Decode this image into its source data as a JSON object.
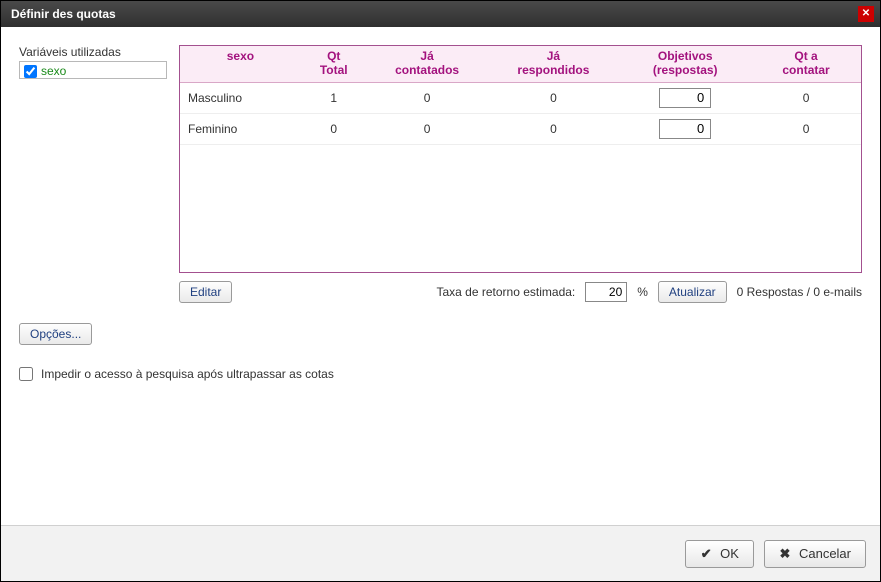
{
  "window": {
    "title": "Définir des quotas"
  },
  "left": {
    "vars_label": "Variáveis utilizadas",
    "vars": [
      {
        "name": "sexo",
        "checked": true
      }
    ]
  },
  "table": {
    "headers": {
      "col0": "sexo",
      "col1_l1": "Qt",
      "col1_l2": "Total",
      "col2_l1": "Já",
      "col2_l2": "contatados",
      "col3_l1": "Já",
      "col3_l2": "respondidos",
      "col4_l1": "Objetivos",
      "col4_l2": "(respostas)",
      "col5_l1": "Qt a",
      "col5_l2": "contatar"
    },
    "rows": [
      {
        "label": "Masculino",
        "qt_total": "1",
        "ja_contatados": "0",
        "ja_respondidos": "0",
        "objetivo": "0",
        "qt_contatar": "0"
      },
      {
        "label": "Feminino",
        "qt_total": "0",
        "ja_contatados": "0",
        "ja_respondidos": "0",
        "objetivo": "0",
        "qt_contatar": "0"
      }
    ]
  },
  "below": {
    "edit_btn": "Editar",
    "rate_label": "Taxa de retorno estimada:",
    "rate_value": "20",
    "pct": "%",
    "refresh_btn": "Atualizar",
    "status": "0 Respostas / 0 e-mails"
  },
  "options_btn": "Opções...",
  "block_checkbox_label": "Impedir o acesso à pesquisa após ultrapassar as cotas",
  "footer": {
    "ok": "OK",
    "cancel": "Cancelar"
  }
}
